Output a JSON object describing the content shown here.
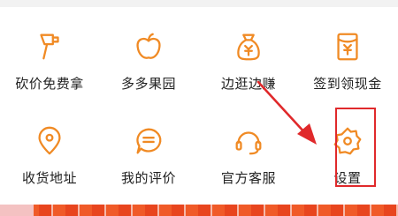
{
  "colors": {
    "icon_stroke": "#f08a24",
    "label_text": "#222222",
    "annotation_red": "#e0292b",
    "banner": "#f05a28"
  },
  "menu": {
    "row1": [
      {
        "label": "砍价免费拿",
        "icon": "axe-icon"
      },
      {
        "label": "多多果园",
        "icon": "apple-icon"
      },
      {
        "label": "边逛边赚",
        "icon": "money-bag-icon"
      },
      {
        "label": "签到领现金",
        "icon": "red-envelope-icon"
      }
    ],
    "row2": [
      {
        "label": "收货地址",
        "icon": "location-pin-icon"
      },
      {
        "label": "我的评价",
        "icon": "comment-icon"
      },
      {
        "label": "官方客服",
        "icon": "headset-icon"
      },
      {
        "label": "设置",
        "icon": "gear-icon"
      }
    ]
  },
  "annotation": {
    "highlighted_item": "设置"
  }
}
